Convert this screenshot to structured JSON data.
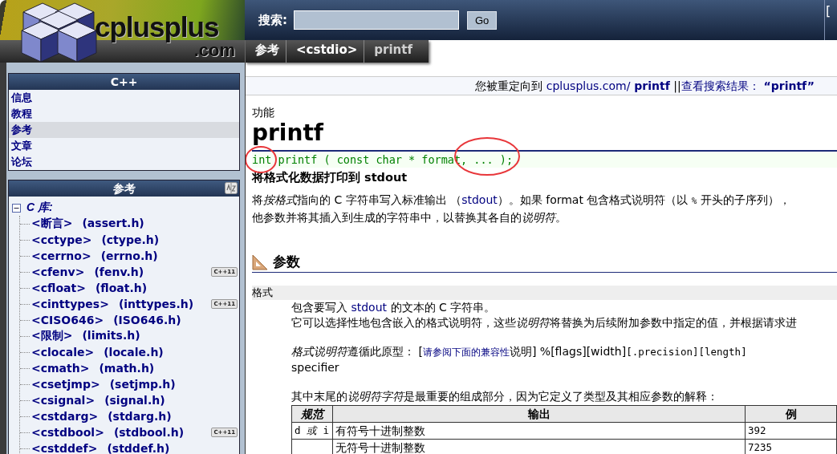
{
  "logo": {
    "name": "cplusplus",
    "domain": ".com"
  },
  "search": {
    "label": "搜索:",
    "button": "Go"
  },
  "top_right_fragment": "[",
  "breadcrumbs": [
    {
      "label": "参考",
      "selected": false
    },
    {
      "label": "<cstdio>",
      "selected": false
    },
    {
      "label": "printf",
      "selected": true
    }
  ],
  "sidebar": {
    "menu": {
      "title": "C++",
      "items": [
        {
          "label": "信息",
          "selected": false
        },
        {
          "label": "教程",
          "selected": false
        },
        {
          "label": "参考",
          "selected": true
        },
        {
          "label": "文章",
          "selected": false
        },
        {
          "label": "论坛",
          "selected": false
        }
      ]
    },
    "reference": {
      "title": "参考",
      "tree": [
        {
          "label": "C 库:",
          "expanded": true,
          "children": [
            {
              "label": "<断言>",
              "file": "(assert.h)"
            },
            {
              "label": "<cctype>",
              "file": "(ctype.h)"
            },
            {
              "label": "<cerrno>",
              "file": "(errno.h)"
            },
            {
              "label": "<cfenv>",
              "file": "(fenv.h)",
              "badge": "C++11"
            },
            {
              "label": "<cfloat>",
              "file": "(float.h)"
            },
            {
              "label": "<cinttypes>",
              "file": "(inttypes.h)",
              "badge": "C++11"
            },
            {
              "label": "<CISO646>",
              "file": "(ISO646.h)"
            },
            {
              "label": "<限制>",
              "file": "(limits.h)"
            },
            {
              "label": "<clocale>",
              "file": "(locale.h)"
            },
            {
              "label": "<cmath>",
              "file": "(math.h)"
            },
            {
              "label": "<csetjmp>",
              "file": "(setjmp.h)"
            },
            {
              "label": "<csignal>",
              "file": "(signal.h)"
            },
            {
              "label": "<cstdarg>",
              "file": "(stdarg.h)"
            },
            {
              "label": "<cstdbool>",
              "file": "(stdbool.h)",
              "badge": "C++11"
            },
            {
              "label": "<cstddef>",
              "file": "(stddef.h)"
            }
          ]
        }
      ]
    }
  },
  "redirect": [
    {
      "kind": "text",
      "text": "您被重定向到 "
    },
    {
      "kind": "link",
      "text": "cplusplus.com/"
    },
    {
      "kind": "strong",
      "text": " printf"
    },
    {
      "kind": "text",
      "text": " ||"
    },
    {
      "kind": "link",
      "text": "查看搜索结果："
    },
    {
      "kind": "strong",
      "text": " “printf”"
    }
  ],
  "kicker": "功能",
  "title": "printf",
  "prototype": "int printf ( const char * format, ... );",
  "summary": "将格式化数据打印到 stdout",
  "description": [
    [
      {
        "kind": "text",
        "text": "将"
      },
      {
        "kind": "em",
        "text": "按格式"
      },
      {
        "kind": "text",
        "text": "指向的 C 字符串写入标准输出 （"
      },
      {
        "kind": "link",
        "text": "stdout"
      },
      {
        "kind": "text",
        "text": "）。如果 format 包含格式说明符（以 "
      },
      {
        "kind": "code",
        "text": "%"
      },
      {
        "kind": "text",
        "text": " 开头的子序列），"
      }
    ],
    [
      {
        "kind": "text",
        "text": "他参数并将其插入到生成的字符串中，以替换其各自的"
      },
      {
        "kind": "em",
        "text": "说明符"
      },
      {
        "kind": "text",
        "text": "。"
      }
    ]
  ],
  "parameters": {
    "heading": "参数",
    "items": [
      {
        "name": "格式",
        "paragraphs": [
          [
            [
              {
                "kind": "text",
                "text": "包含要写入 "
              },
              {
                "kind": "link",
                "text": "stdout"
              },
              {
                "kind": "text",
                "text": " 的文本的 C 字符串。"
              }
            ],
            [
              {
                "kind": "text",
                "text": "它可以选择性地包含嵌入的格式说明符，这些"
              },
              {
                "kind": "em",
                "text": "说明符"
              },
              {
                "kind": "text",
                "text": "将替换为后续附加参数中指定的值，并根据请求进"
              }
            ]
          ],
          [
            [
              {
                "kind": "em",
                "text": "格式说明符"
              },
              {
                "kind": "text",
                "text": "遵循此原型： ["
              },
              {
                "kind": "small-link",
                "text": "请参阅下面的兼容性"
              },
              {
                "kind": "text",
                "text": "说明] %[flags][width]"
              },
              {
                "kind": "code",
                "text": "[.precision][length]"
              }
            ],
            [
              {
                "kind": "text",
                "text": "specifier"
              }
            ]
          ],
          [
            [
              {
                "kind": "text",
                "text": "其中末尾的"
              },
              {
                "kind": "em",
                "text": "说明符字符"
              },
              {
                "kind": "text",
                "text": "是最重要的组成部分，因为它定义了类型及其相应参数的解释："
              }
            ]
          ]
        ],
        "table": {
          "columns": [
            "规范",
            "输出",
            "例"
          ],
          "rows": [
            [
              "d *或* i",
              "有符号十进制整数",
              "392"
            ],
            [
              "",
              "无符号十进制整数",
              "7235"
            ]
          ]
        }
      }
    ]
  }
}
